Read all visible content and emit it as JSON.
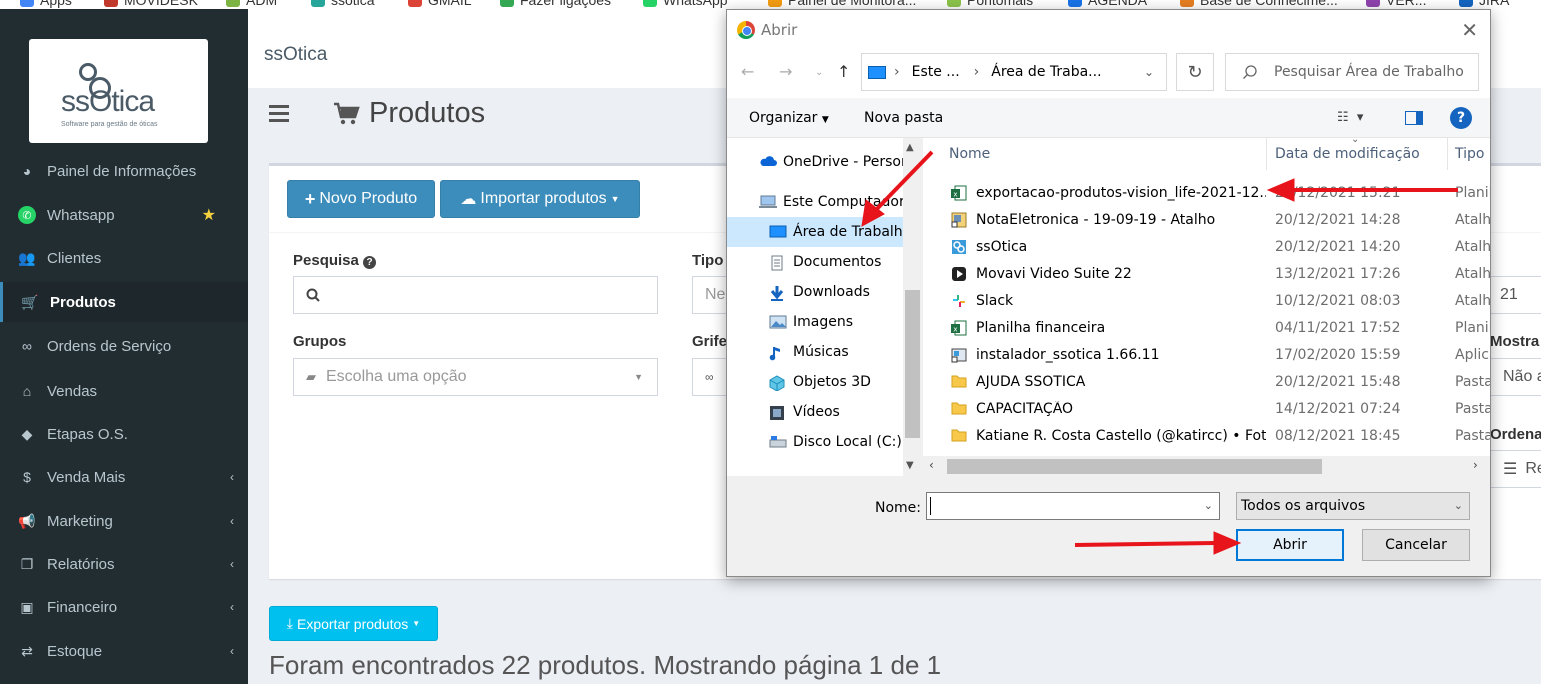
{
  "bookmarks": [
    "Apps",
    "MOVIDESK",
    "ADM",
    "ssotica",
    "GMAIL",
    "Fazer ligações",
    "WhatsApp",
    "Painel de Monitora...",
    "Pontomais",
    "AGENDA",
    "Base de Conhecime...",
    "VER...",
    "JIRA"
  ],
  "sidebar": {
    "logo_text": "ssOtica",
    "logo_sub": "Software para gestão de óticas",
    "items": [
      {
        "label": "Painel de Informações",
        "icon": "dashboard-icon"
      },
      {
        "label": "Whatsapp",
        "icon": "whatsapp-icon"
      },
      {
        "label": "Clientes",
        "icon": "users-icon"
      },
      {
        "label": "Produtos",
        "icon": "cart-icon"
      },
      {
        "label": "Ordens de Serviço",
        "icon": "glasses-icon"
      },
      {
        "label": "Vendas",
        "icon": "basket-icon"
      },
      {
        "label": "Etapas O.S.",
        "icon": "tag-icon"
      },
      {
        "label": "Venda Mais",
        "icon": "dollar-icon"
      },
      {
        "label": "Marketing",
        "icon": "bullhorn-icon"
      },
      {
        "label": "Relatórios",
        "icon": "copy-icon"
      },
      {
        "label": "Financeiro",
        "icon": "money-icon"
      },
      {
        "label": "Estoque",
        "icon": "exchange-icon"
      }
    ]
  },
  "header": {
    "small_logo": "ssOtica",
    "page_title": "Produtos"
  },
  "content": {
    "new_product": "Novo Produto",
    "import_products": "Importar produtos",
    "search_label": "Pesquisa",
    "type_label": "Tipo",
    "type_placeholder": "Ne",
    "groups_label": "Grupos",
    "groups_placeholder": "Escolha uma opção",
    "brand_label": "Grife",
    "export_products": "Exportar produtos",
    "summary": "Foram encontrados 22 produtos. Mostrando página 1 de 1",
    "peek_value": "21",
    "peek_mostrar": "Mostra",
    "peek_nao": "Não a",
    "peek_ordena": "Ordena",
    "peek_re": "Re"
  },
  "dialog": {
    "title": "Abrir",
    "breadcrumb": [
      "Este ...",
      "Área de Traba..."
    ],
    "search_placeholder": "Pesquisar Área de Trabalho",
    "organize": "Organizar",
    "new_folder": "Nova pasta",
    "tree": [
      {
        "label": "OneDrive - Person",
        "icon": "cloud-icon"
      },
      {
        "label": "Este Computador",
        "icon": "computer-icon"
      },
      {
        "label": "Área de Trabalho",
        "icon": "desktop-icon"
      },
      {
        "label": "Documentos",
        "icon": "documents-icon"
      },
      {
        "label": "Downloads",
        "icon": "download-icon"
      },
      {
        "label": "Imagens",
        "icon": "images-icon"
      },
      {
        "label": "Músicas",
        "icon": "music-icon"
      },
      {
        "label": "Objetos 3D",
        "icon": "cube-icon"
      },
      {
        "label": "Vídeos",
        "icon": "video-icon"
      },
      {
        "label": "Disco Local (C:)",
        "icon": "disk-icon"
      }
    ],
    "columns": [
      "Nome",
      "Data de modificação",
      "Tipo"
    ],
    "files": [
      {
        "name": "exportacao-produtos-vision_life-2021-12...",
        "date": "20/12/2021 15:21",
        "type": "Planil",
        "icon": "excel-icon"
      },
      {
        "name": "NotaEletronica - 19-09-19 - Atalho",
        "date": "20/12/2021 14:28",
        "type": "Atalh",
        "icon": "shortcut-icon"
      },
      {
        "name": "ssOtica",
        "date": "20/12/2021 14:20",
        "type": "Atalh",
        "icon": "ssotica-icon"
      },
      {
        "name": "Movavi Video Suite 22",
        "date": "13/12/2021 17:26",
        "type": "Atalh",
        "icon": "movavi-icon"
      },
      {
        "name": "Slack",
        "date": "10/12/2021 08:03",
        "type": "Atalh",
        "icon": "slack-icon"
      },
      {
        "name": "Planilha financeira",
        "date": "04/11/2021 17:52",
        "type": "Planil",
        "icon": "excel-icon"
      },
      {
        "name": "instalador_ssotica 1.66.11",
        "date": "17/02/2020 15:59",
        "type": "Aplica",
        "icon": "installer-icon"
      },
      {
        "name": "AJUDA SSOTICA",
        "date": "20/12/2021 15:48",
        "type": "Pasta",
        "icon": "folder-icon"
      },
      {
        "name": "CAPACITAÇÃO",
        "date": "14/12/2021 07:24",
        "type": "Pasta",
        "icon": "folder-icon"
      },
      {
        "name": "Katiane R. Costa Castello (@katircc) • Fot...",
        "date": "08/12/2021 18:45",
        "type": "Pasta",
        "icon": "folder-icon"
      }
    ],
    "name_label": "Nome:",
    "name_value": "",
    "filter": "Todos os arquivos",
    "open": "Abrir",
    "cancel": "Cancelar"
  },
  "colors": {
    "sidebar_bg": "#222d32",
    "primary": "#3c8dbc",
    "info": "#00c0ef",
    "arrow": "#e8141b"
  }
}
